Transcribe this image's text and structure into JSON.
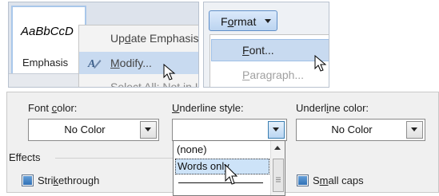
{
  "style_gallery": {
    "preview_text": "AaBbCcD",
    "style_name": "Emphasis"
  },
  "context_menu": {
    "items": [
      {
        "pre": "Up",
        "key": "d",
        "post": "ate Emphasis",
        "icon": "none"
      },
      {
        "pre": "",
        "key": "M",
        "post": "odify...",
        "icon": "modify-style-icon",
        "highlighted": true
      },
      {
        "pre": "Se",
        "key": "",
        "post": "lect All: Not in Use",
        "icon": "none",
        "clipped": true
      }
    ]
  },
  "format_menu": {
    "button": {
      "pre": "F",
      "key": "o",
      "post": "rmat",
      "arrow": "dropdown-triangle-icon"
    },
    "items": [
      {
        "pre": "",
        "key": "F",
        "post": "ont...",
        "highlighted": true
      },
      {
        "pre": "",
        "key": "P",
        "post": "aragraph...",
        "disabled": true
      }
    ]
  },
  "font_dialog": {
    "font_color": {
      "pre": "Font ",
      "key": "c",
      "post": "olor:",
      "value": "No Color"
    },
    "underline_style": {
      "pre": "",
      "key": "U",
      "post": "nderline style:",
      "value": ""
    },
    "underline_color": {
      "pre": "Underl",
      "key": "i",
      "post": "ne color:",
      "value": "No Color"
    },
    "effects_heading": "Effects",
    "underline_options": [
      "(none)",
      "Words only"
    ],
    "strikethrough": {
      "pre": "Stri",
      "key": "k",
      "post": "ethrough",
      "checked": false
    },
    "small_caps": {
      "pre": "S",
      "key": "m",
      "post": "all caps",
      "checked": false
    }
  },
  "colors": {
    "highlight": "#c8daf0",
    "button_blue": "#bcd4f0",
    "checkbox": "#2c6db3"
  }
}
